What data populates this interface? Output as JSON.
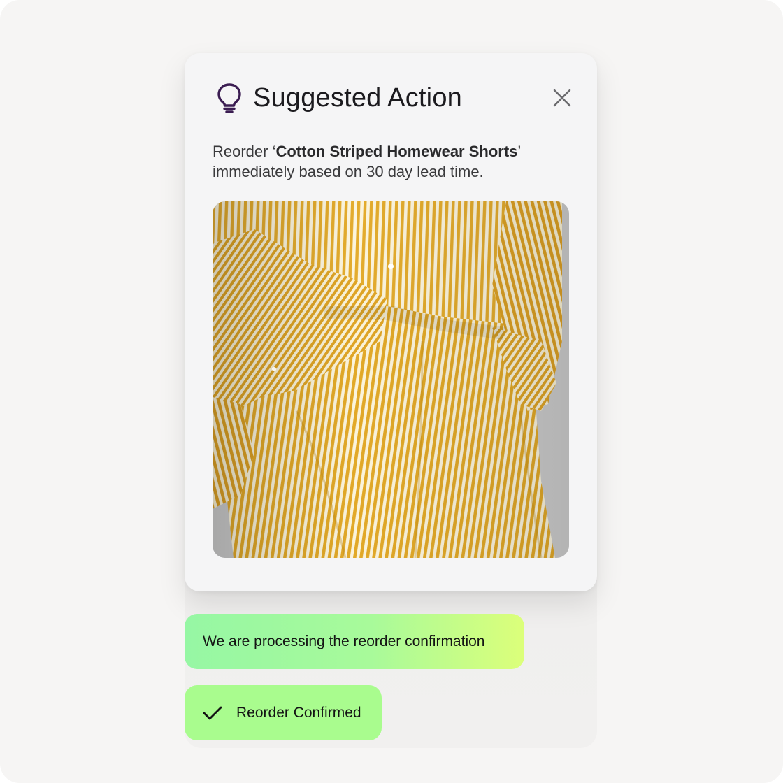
{
  "suggestion_card": {
    "title": "Suggested Action",
    "title_icon": "lightbulb-icon",
    "close_icon": "close-icon",
    "message_prefix": "Reorder ‘",
    "product_name": "Cotton Striped Homewear Shorts",
    "message_suffix_quote": "’",
    "message_line2": "immediately based on 30 day lead time.",
    "image_subject": "yellow-white-striped-shorts-photo"
  },
  "status": {
    "processing_text": "We are processing the reorder confirmation",
    "confirmed_text": "Reorder Confirmed",
    "confirmed_icon": "checkmark-icon"
  },
  "colors": {
    "icon_accent": "#3b1d52",
    "pill_green": "#a9fc8e",
    "pill_gradient_start": "#96f7a4",
    "pill_gradient_end": "#dcff7a",
    "stripe_yellow": "#e2a928"
  }
}
